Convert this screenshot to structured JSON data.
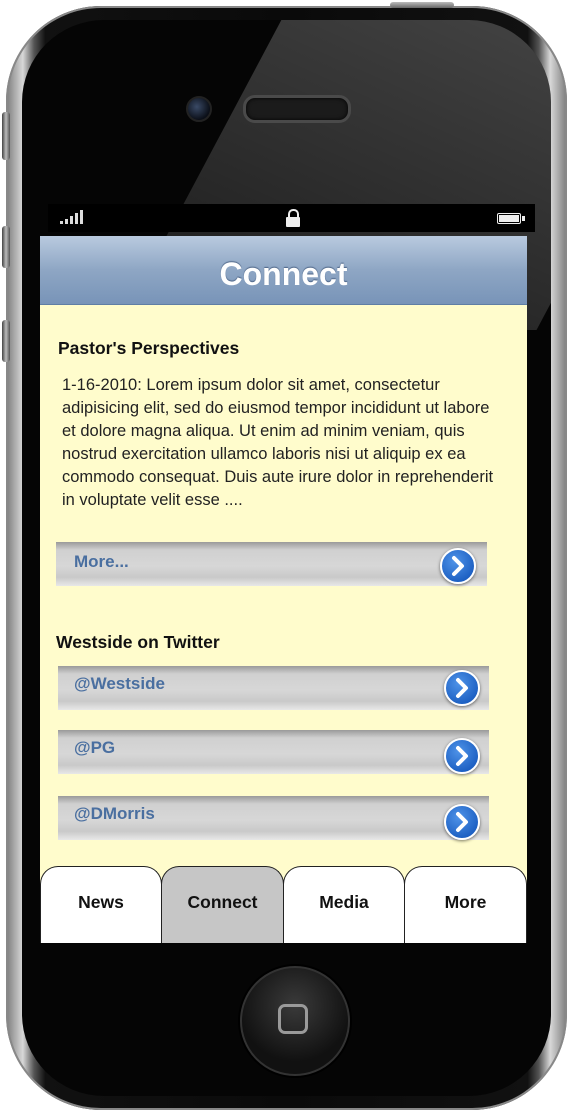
{
  "status_bar": {
    "signal_icon": "signal-bars-icon",
    "lock_icon": "lock-icon",
    "battery_icon": "battery-icon"
  },
  "nav": {
    "title": "Connect"
  },
  "pastor": {
    "heading": "Pastor's Perspectives",
    "body": "1-16-2010:  Lorem ipsum dolor sit amet, consectetur adipisicing elit, sed do eiusmod tempor incididunt ut labore et dolore magna aliqua. Ut enim ad minim veniam, quis nostrud exercitation ullamco laboris nisi ut aliquip ex ea commodo consequat. Duis aute irure dolor in reprehenderit in voluptate velit esse ....",
    "more_label": "More..."
  },
  "twitter": {
    "heading": "Westside on Twitter",
    "items": [
      {
        "label": "@Westside"
      },
      {
        "label": "@PG"
      },
      {
        "label": "@DMorris"
      }
    ]
  },
  "tabs": [
    {
      "label": "News",
      "active": false
    },
    {
      "label": "Connect",
      "active": true
    },
    {
      "label": "Media",
      "active": false
    },
    {
      "label": "More",
      "active": false
    }
  ],
  "colors": {
    "screen_background": "#fffccc",
    "nav_bar": "#8ea6c4",
    "link_text": "#4a6fa0",
    "chevron_button": "#1c5fc2",
    "active_tab": "#c6c6c6"
  }
}
